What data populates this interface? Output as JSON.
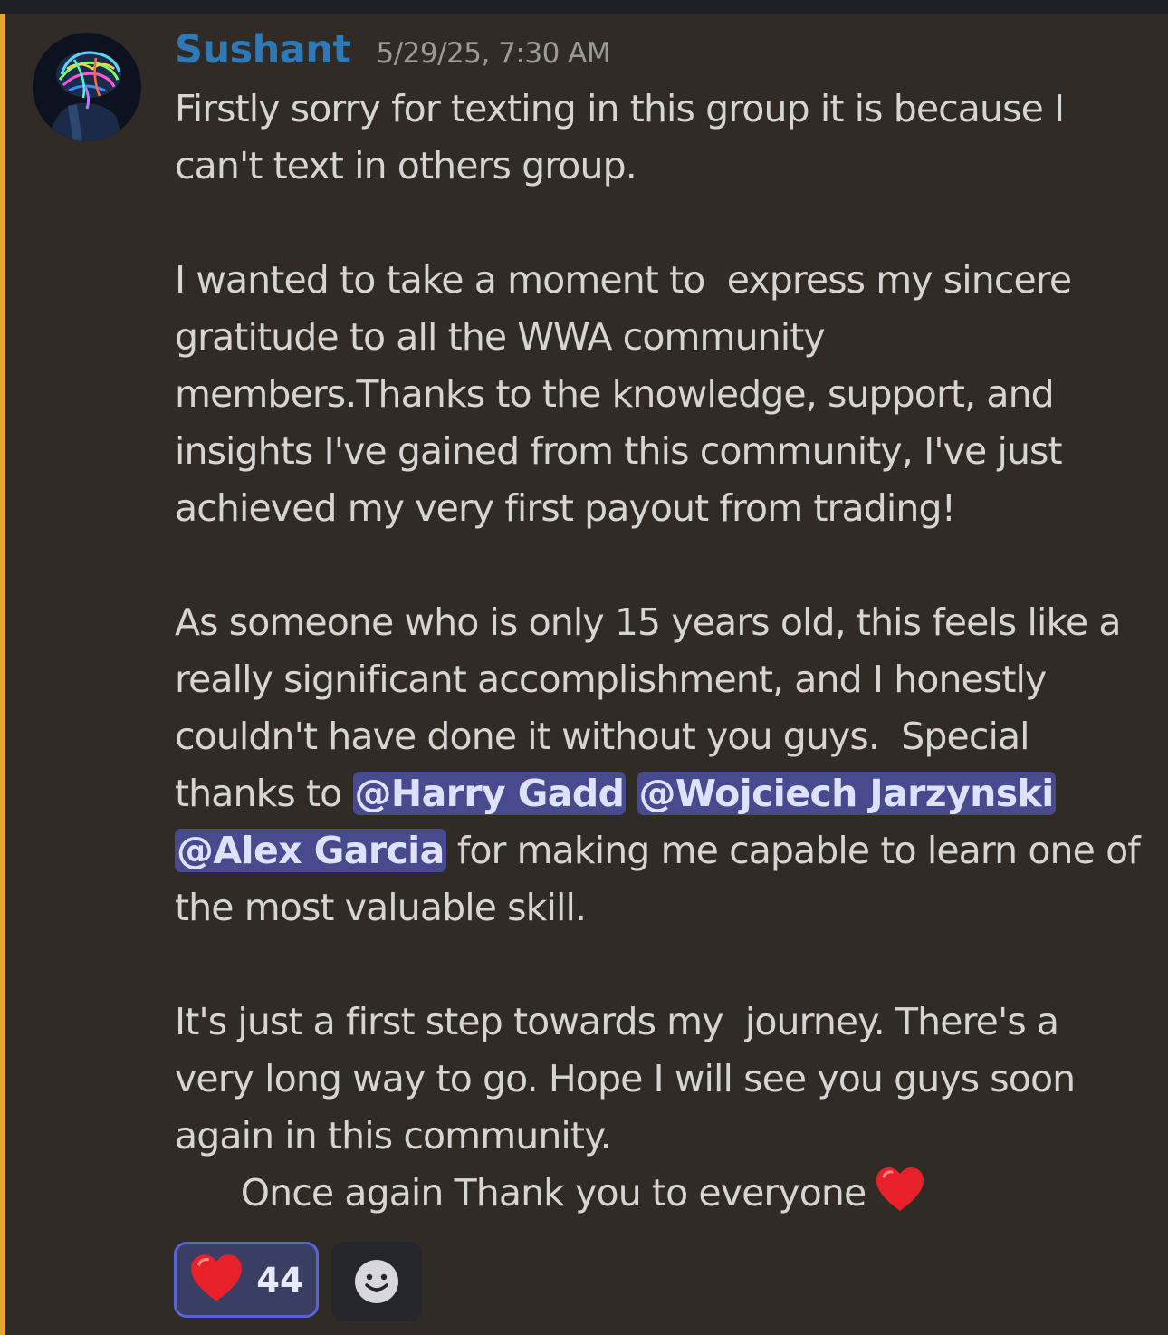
{
  "message": {
    "author": "Sushant",
    "timestamp": "5/29/25, 7:30 AM",
    "lines": {
      "l1": "Firstly sorry for texting in this group it is because I",
      "l2": "can't text in others group.",
      "l4": "I wanted to take a moment to  express my sincere",
      "l5": "gratitude to all the WWA community",
      "l6": "members.Thanks to the knowledge, support, and",
      "l7": "insights I've gained from this community, I've just",
      "l8": "achieved my very first payout from trading!",
      "l10": "As someone who is only 15 years old, this feels like a",
      "l11": "really significant accomplishment, and I honestly",
      "l12": "couldn't have done it without you guys.  Special",
      "l13_prefix": "thanks to ",
      "l14_suffix": " for making me capable to learn one of",
      "l15": "the most valuable skill.",
      "l17": "It's just a first step towards my  journey. There's a",
      "l18": "very long way to go. Hope I will see you guys soon",
      "l19": "again in this community.",
      "l20": "      Once again Thank you to everyone"
    },
    "mentions": [
      "@Harry Gadd",
      "@Wojciech Jarzynski",
      "@Alex Garcia"
    ],
    "closing_emoji": "red-heart"
  },
  "reactions": [
    {
      "emoji": "red-heart",
      "count": "44",
      "active": true
    }
  ],
  "colors": {
    "background": "#302b25",
    "highlight_bar": "#e2a52c",
    "username": "#2e7ab8",
    "mention_bg": "#474a8c",
    "reaction_border": "#5865d6"
  }
}
